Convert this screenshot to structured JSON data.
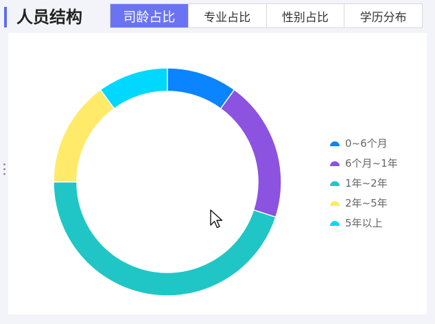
{
  "header": {
    "title": "人员结构",
    "tabs": [
      {
        "label": "司龄占比",
        "active": true
      },
      {
        "label": "专业占比",
        "active": false
      },
      {
        "label": "性别占比",
        "active": false
      },
      {
        "label": "学历分布",
        "active": false
      }
    ]
  },
  "colors": {
    "accent": "#6a74f3",
    "title_bar": "#5b6bf0"
  },
  "chart_data": {
    "type": "pie",
    "donut": true,
    "legend_position": "right",
    "categories": [
      "0~6个月",
      "6个月~1年",
      "1年~2年",
      "2年~5年",
      "5年以上"
    ],
    "values": [
      10,
      20,
      45,
      15,
      10
    ],
    "colors": [
      "#0a84ff",
      "#8c52e0",
      "#20c6c6",
      "#ffea6a",
      "#00d8ff"
    ]
  }
}
